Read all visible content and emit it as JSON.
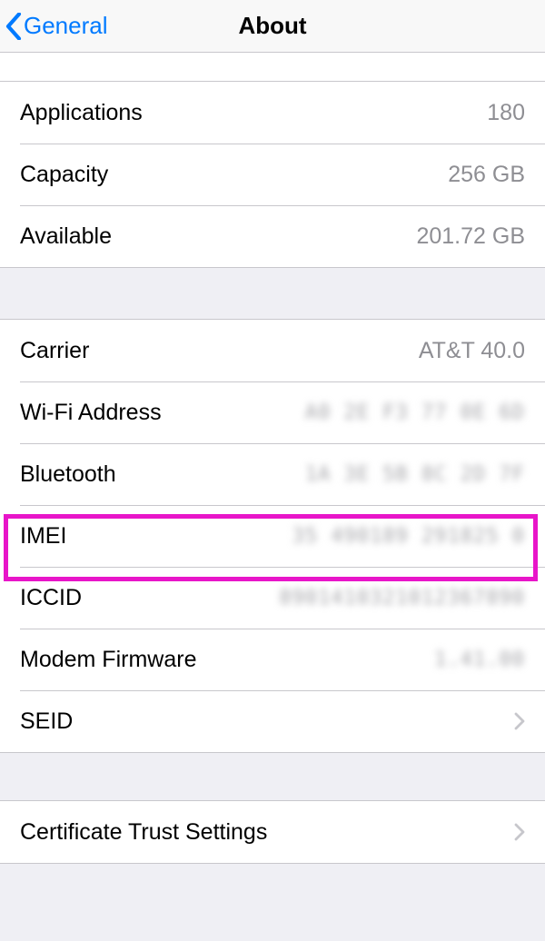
{
  "navbar": {
    "back_label": "General",
    "title": "About"
  },
  "group1": {
    "applications": {
      "label": "Applications",
      "value": "180"
    },
    "capacity": {
      "label": "Capacity",
      "value": "256 GB"
    },
    "available": {
      "label": "Available",
      "value": "201.72 GB"
    }
  },
  "group2": {
    "carrier": {
      "label": "Carrier",
      "value": "AT&T 40.0"
    },
    "wifi": {
      "label": "Wi-Fi Address",
      "value": "A0 2E F3 77 0E 6D"
    },
    "bluetooth": {
      "label": "Bluetooth",
      "value": "1A 3E 5B 8C 2D 7F"
    },
    "imei": {
      "label": "IMEI",
      "value": "35 490189 291825 0"
    },
    "iccid": {
      "label": "ICCID",
      "value": "8901410321012367890"
    },
    "modem": {
      "label": "Modem Firmware",
      "value": "1.41.00"
    },
    "seid": {
      "label": "SEID"
    }
  },
  "group3": {
    "cert": {
      "label": "Certificate Trust Settings"
    }
  }
}
